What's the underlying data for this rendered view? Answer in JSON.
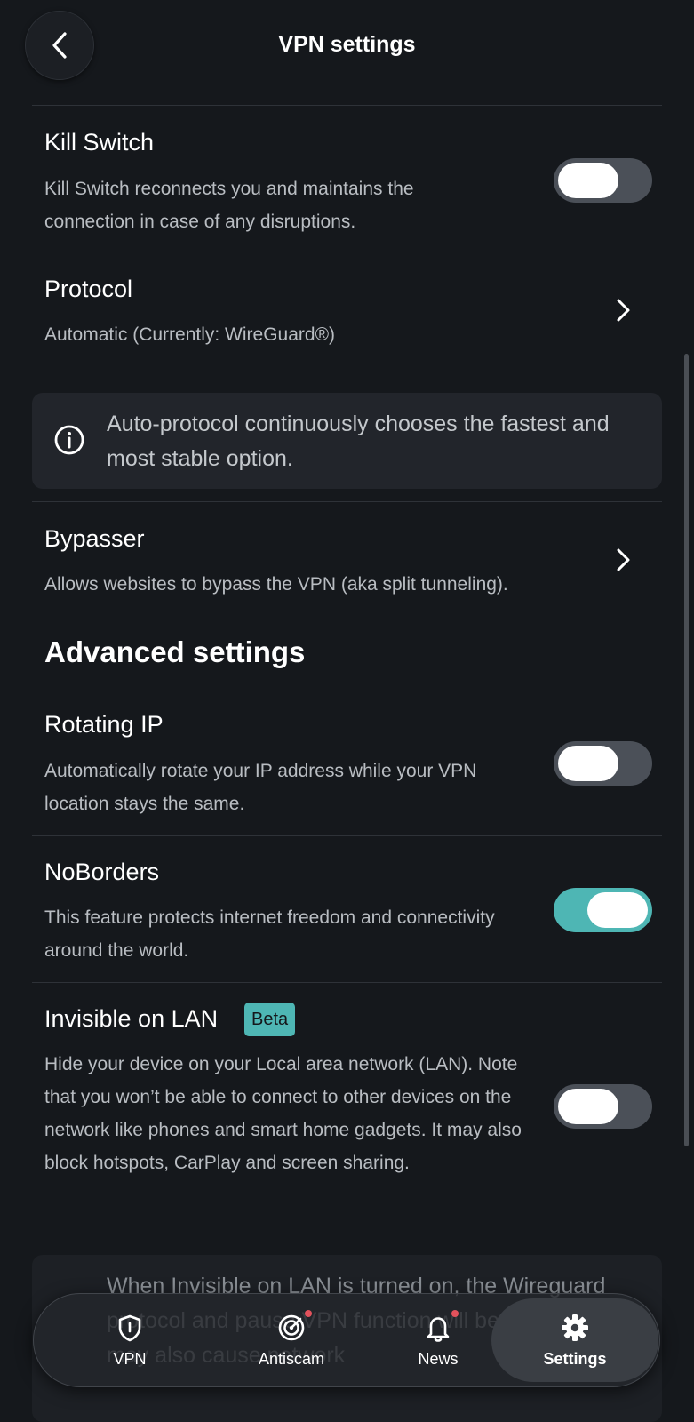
{
  "header": {
    "title": "VPN settings",
    "back_icon": "chevron-left-icon"
  },
  "kill_switch": {
    "title": "Kill Switch",
    "description": "Kill Switch reconnects you and maintains the connection in case of any disruptions.",
    "enabled": false
  },
  "protocol": {
    "title": "Protocol",
    "value": "Automatic (Currently: WireGuard®)",
    "chevron_icon": "chevron-right-icon"
  },
  "protocol_info": {
    "icon": "info-icon",
    "text": "Auto-protocol continuously chooses the fastest and most stable option."
  },
  "bypasser": {
    "title": "Bypasser",
    "description": "Allows websites to bypass the VPN (aka split tunneling).",
    "chevron_icon": "chevron-right-icon"
  },
  "advanced": {
    "section_title": "Advanced settings",
    "rotating_ip": {
      "title": "Rotating IP",
      "description": "Automatically rotate your IP address while your VPN location stays the same.",
      "enabled": false
    },
    "noborders": {
      "title": "NoBorders",
      "description": "This feature protects internet freedom and connectivity around the world.",
      "enabled": true
    },
    "invisible_lan": {
      "title": "Invisible on LAN",
      "badge": "Beta",
      "description": "Hide your device on your Local area network (LAN). Note that you won’t be able to connect to other devices on the network like phones and smart home gadgets. It may also block hotspots, CarPlay and screen sharing.",
      "enabled": false
    },
    "lan_warning": {
      "text": "When Invisible on LAN is turned on, the Wireguard protocol and pause VPN function will be unavailable. It may also cause network"
    }
  },
  "tabbar": {
    "tabs": [
      {
        "label": "VPN",
        "icon": "shield-icon"
      },
      {
        "label": "Antiscam",
        "icon": "antiscam-icon",
        "has_notification": true
      },
      {
        "label": "News",
        "icon": "bell-icon",
        "has_notification": true
      },
      {
        "label": "Settings",
        "icon": "gear-icon",
        "active": true
      }
    ]
  },
  "colors": {
    "background": "#15181c",
    "accent": "#4eb6b4",
    "notification_dot": "#e2525c"
  }
}
